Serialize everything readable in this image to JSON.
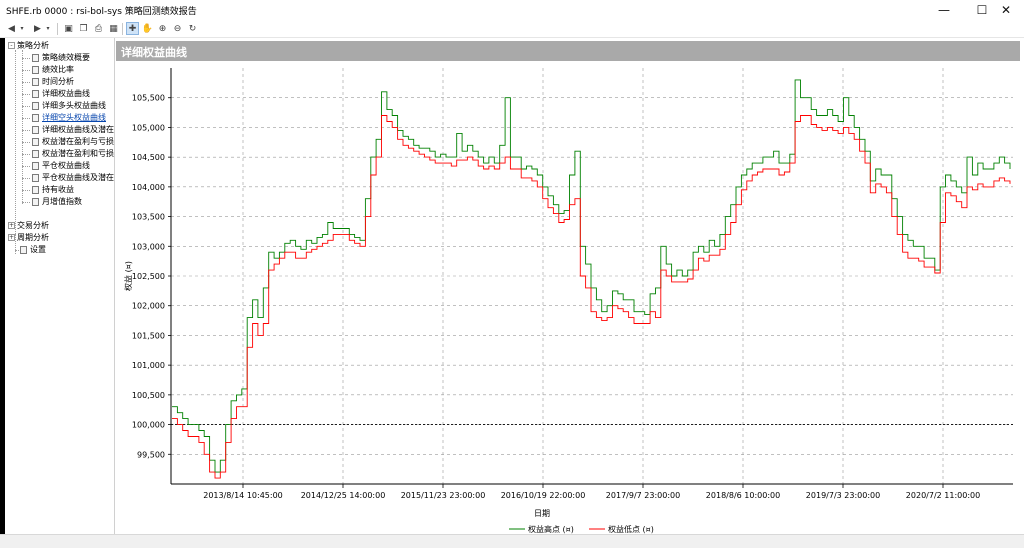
{
  "window": {
    "title": "SHFE.rb 0000 : rsi-bol-sys 策略回测绩效报告",
    "minimize_icon": "minimize-icon",
    "maximize_icon": "maximize-icon",
    "close_icon": "close-icon"
  },
  "toolbar": {
    "icons": [
      "back-icon",
      "forward-icon",
      "save-icon",
      "copy-icon",
      "print-icon",
      "export-icon",
      "pointer-icon",
      "hand-pan-icon",
      "zoom-in-icon",
      "zoom-out-icon",
      "reset-zoom-icon"
    ]
  },
  "tree": {
    "root": "策略分析",
    "items": [
      "策略绩效概要",
      "绩效比率",
      "时间分析",
      "详细权益曲线",
      "详细多头权益曲线",
      "详细空头权益曲线",
      "详细权益曲线及潜在",
      "权益潜在盈利与亏损",
      "权益潜在盈利和亏损",
      "平仓权益曲线",
      "平仓权益曲线及潜在",
      "持有收益",
      "月增值指数"
    ],
    "selected_index": 5,
    "trade_analysis": "交易分析",
    "period_analysis": "周期分析",
    "settings": "设置"
  },
  "panel": {
    "header": "详细权益曲线"
  },
  "chart_data": {
    "type": "line",
    "ylabel": "权益 (¤)",
    "xlabel": "日期",
    "ylim": [
      99000,
      106000
    ],
    "yticks": [
      99500,
      100000,
      100500,
      101000,
      101500,
      102000,
      102500,
      103000,
      103500,
      104000,
      104500,
      105000,
      105500
    ],
    "ytick_labels": [
      "99,500",
      "100,000",
      "100,500",
      "101,000",
      "101,500",
      "102,000",
      "102,500",
      "103,000",
      "103,500",
      "104,000",
      "104,500",
      "105,000",
      "105,500"
    ],
    "xticks": [
      "2013/8/14 10:45:00",
      "2014/12/25 14:00:00",
      "2015/11/23 23:00:00",
      "2016/10/19 22:00:00",
      "2017/9/7 23:00:00",
      "2018/8/6 10:00:00",
      "2019/7/3 23:00:00",
      "2020/7/2 11:00:00"
    ],
    "reference_line": 100000,
    "grid": true,
    "legend_position": "bottom-center",
    "series": [
      {
        "name": "权益高点 (¤)",
        "color": "#008000",
        "values": [
          100300,
          100200,
          100100,
          100000,
          100000,
          99900,
          99800,
          99400,
          99200,
          99400,
          100000,
          100400,
          100500,
          100600,
          101800,
          102100,
          101800,
          102300,
          102900,
          102800,
          102900,
          103050,
          103100,
          103000,
          102950,
          103100,
          103050,
          103150,
          103200,
          103400,
          103300,
          103300,
          103300,
          103200,
          103150,
          103100,
          103800,
          104500,
          104800,
          105600,
          105300,
          105200,
          104950,
          104850,
          104800,
          104700,
          104650,
          104650,
          104600,
          104500,
          104550,
          104500,
          104500,
          104900,
          104600,
          104700,
          104600,
          104500,
          104400,
          104500,
          104400,
          104700,
          105500,
          104500,
          104500,
          104300,
          104350,
          104300,
          104200,
          104000,
          103850,
          103700,
          103550,
          103600,
          104200,
          104600,
          103000,
          102700,
          102300,
          102100,
          101900,
          102000,
          102250,
          102200,
          102100,
          102100,
          101900,
          101900,
          101850,
          102200,
          102300,
          103000,
          102700,
          102500,
          102600,
          102500,
          102600,
          102900,
          103000,
          102900,
          103100,
          103000,
          103200,
          103500,
          103700,
          104000,
          104200,
          104300,
          104400,
          104400,
          104500,
          104500,
          104600,
          104400,
          104400,
          104550,
          105800,
          105500,
          105500,
          105300,
          105200,
          105200,
          105300,
          105200,
          105100,
          105500,
          105200,
          105000,
          104800,
          104600,
          104100,
          104300,
          104200,
          104200,
          103800,
          103500,
          103200,
          103100,
          103000,
          103000,
          102800,
          102800,
          102600,
          104000,
          104200,
          104100,
          104000,
          103900,
          104500,
          104200,
          104400,
          104300,
          104300,
          104400,
          104500,
          104400,
          104300
        ]
      },
      {
        "name": "权益低点 (¤)",
        "color": "#ff0000",
        "values": [
          100100,
          100000,
          99900,
          99800,
          99800,
          99700,
          99500,
          99200,
          99100,
          99200,
          99700,
          100100,
          100300,
          100300,
          101300,
          101700,
          101500,
          101700,
          102600,
          102700,
          102800,
          102900,
          102900,
          102800,
          102800,
          102900,
          102950,
          103000,
          103050,
          103100,
          103200,
          103200,
          103200,
          103100,
          103050,
          103000,
          103500,
          104200,
          104500,
          105200,
          105100,
          105000,
          104800,
          104700,
          104650,
          104600,
          104550,
          104500,
          104450,
          104400,
          104400,
          104400,
          104350,
          104450,
          104450,
          104500,
          104450,
          104350,
          104300,
          104350,
          104300,
          104400,
          104500,
          104300,
          104300,
          104150,
          104150,
          104100,
          104000,
          103800,
          103650,
          103550,
          103400,
          103450,
          103700,
          103800,
          102500,
          102300,
          101900,
          101800,
          101750,
          101800,
          102000,
          101950,
          101900,
          101800,
          101700,
          101700,
          101700,
          101900,
          101800,
          102600,
          102500,
          102400,
          102400,
          102400,
          102450,
          102600,
          102800,
          102750,
          102850,
          102850,
          102950,
          103200,
          103400,
          103700,
          103950,
          104100,
          104200,
          104250,
          104300,
          104300,
          104300,
          104200,
          104250,
          104400,
          105100,
          105200,
          105200,
          105050,
          105000,
          104950,
          105000,
          104950,
          104900,
          105000,
          104900,
          104800,
          104600,
          104400,
          103900,
          104050,
          104000,
          103900,
          103500,
          103200,
          102900,
          102800,
          102800,
          102750,
          102650,
          102650,
          102550,
          103400,
          103900,
          103850,
          103750,
          103650,
          104000,
          103950,
          104050,
          104000,
          104000,
          104100,
          104150,
          104100,
          104050
        ]
      }
    ]
  }
}
